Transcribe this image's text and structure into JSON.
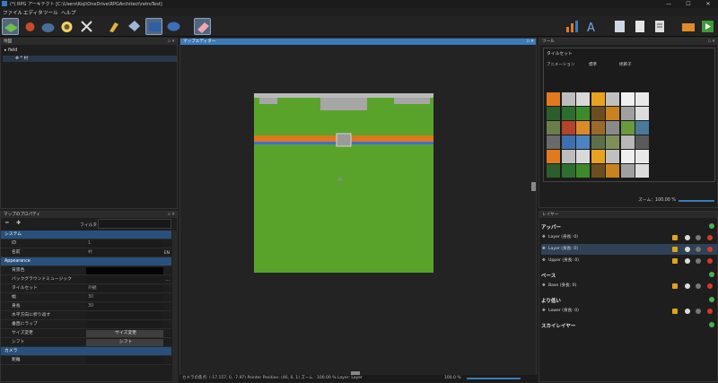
{
  "window": {
    "title": "(*) RPG アーキテクト [C:\\Users\\Koji\\OneDrive\\RPGArchitect\\retroTest]",
    "minimize": "—",
    "maximize": "☐",
    "close": "✕"
  },
  "menu": [
    "ファイル",
    "エディタ",
    "ツール",
    "ヘルプ"
  ],
  "map_panel": {
    "title": "地図",
    "tree": [
      {
        "label": "field",
        "icon": "expand-icon"
      },
      {
        "label": "* 村",
        "icon": "move-icon"
      }
    ]
  },
  "editor": {
    "title": "マップエディター"
  },
  "props": {
    "title": "マップのプロパティ",
    "filter_label": "フィルター:",
    "filter_value": "",
    "sections": [
      {
        "name": "システム",
        "rows": [
          {
            "k": "ID",
            "v": "1"
          },
          {
            "k": "名前",
            "v": "村",
            "extra": "EN"
          }
        ]
      },
      {
        "name": "Appearance",
        "rows": [
          {
            "k": "背景色",
            "v": ""
          },
          {
            "k": "バックグラウンドミュージック",
            "v": "",
            "extra": "..."
          },
          {
            "k": "タイルセット",
            "v": "外観"
          },
          {
            "k": "幅",
            "v": "30"
          },
          {
            "k": "身長",
            "v": "30"
          },
          {
            "k": "水平方向に折り返す",
            "v": ""
          },
          {
            "k": "垂直にラップ",
            "v": ""
          },
          {
            "k": "サイズ変更",
            "v": "サイズ変更"
          },
          {
            "k": "シフト",
            "v": "シフト"
          }
        ]
      },
      {
        "name": "カメラ",
        "rows": [
          {
            "k": "距離",
            "v": ""
          }
        ]
      }
    ]
  },
  "tools": {
    "title": "ツール",
    "tileset_label": "タイルセット",
    "tabs": [
      "アニメーション",
      "標準",
      "修飾子"
    ],
    "zoom_label": "ズーム：",
    "zoom_value": "100.00 %"
  },
  "layers": {
    "title": "レイヤー",
    "groups": [
      {
        "name": "アッパー",
        "items": [
          "Layer (身長: 0)",
          "Layer (身長: 0)",
          "Upper (身長: 0)"
        ]
      },
      {
        "name": "ベース",
        "items": [
          "Base (身長: 0)"
        ]
      },
      {
        "name": "より低い",
        "items": [
          "Lower (身長: 0)"
        ]
      },
      {
        "name": "スカイレイヤー",
        "items": []
      }
    ]
  },
  "status": {
    "text": "カメラの焦点: (-17.157, 0, -7.97) Pointer Position: (46, 0, 1)  ズーム : 100.00 %  Layer: Layer",
    "zoom": "100.0 %"
  },
  "colors": {
    "accent": "#3b7bb9",
    "grass": "#5aa32b",
    "water": "#3a6fd6",
    "lava": "#e0761c"
  }
}
